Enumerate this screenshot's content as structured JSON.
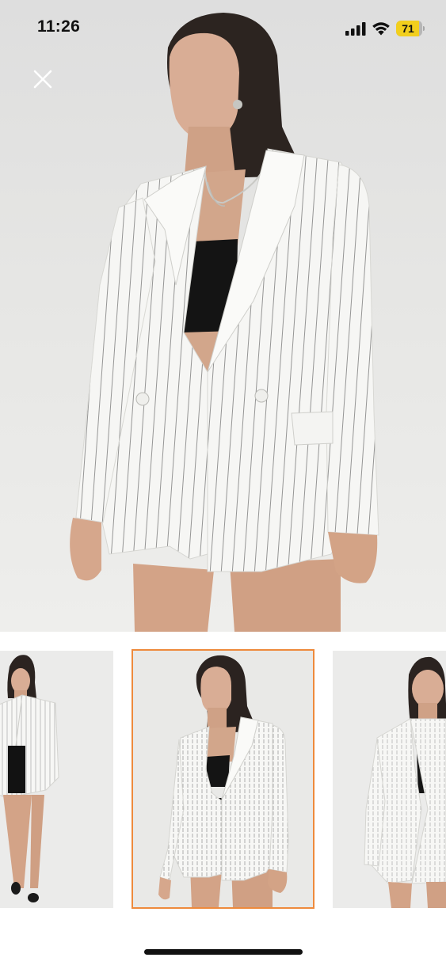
{
  "status_bar": {
    "time": "11:26",
    "battery_level": "71",
    "battery_color": "#f2cf1d"
  },
  "viewer": {
    "close_icon": "close-icon",
    "selected_thumbnail_index": 1,
    "accent_color": "#ee8a3c",
    "thumbnails": [
      {
        "icon": "photo-thumbnail",
        "selected": false
      },
      {
        "icon": "photo-thumbnail",
        "selected": true
      },
      {
        "icon": "photo-thumbnail",
        "selected": false
      }
    ]
  }
}
